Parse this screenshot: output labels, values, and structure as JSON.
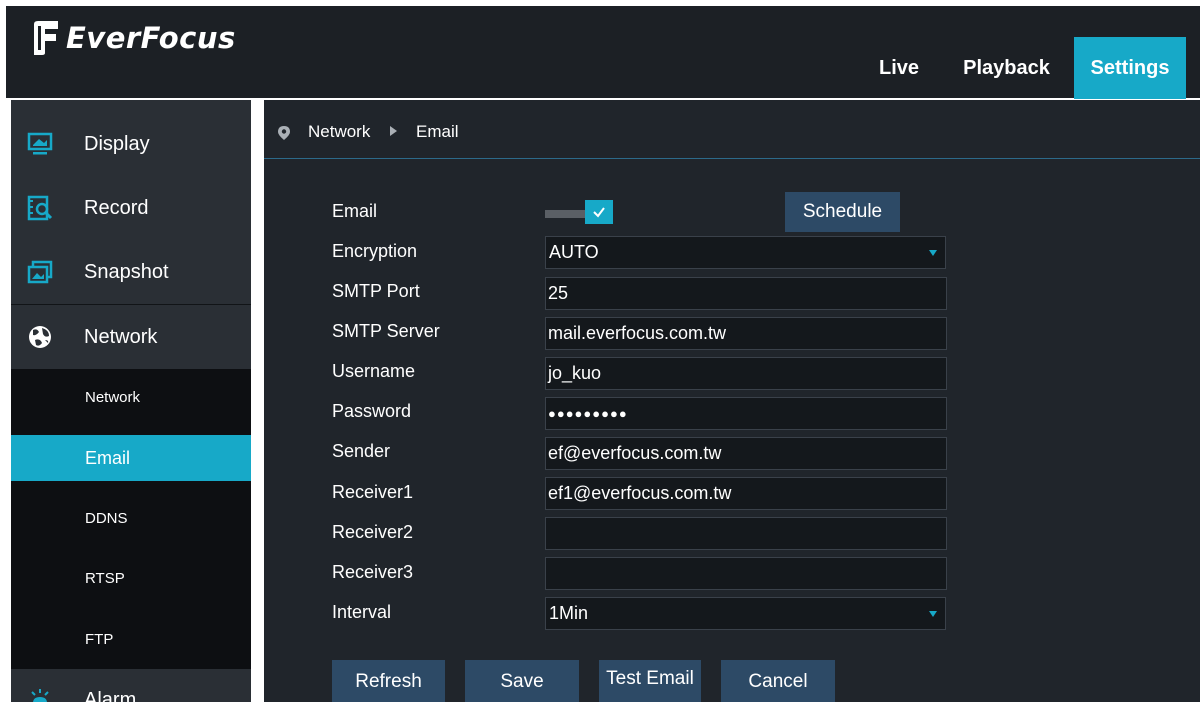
{
  "brand": {
    "name": "EverFocus"
  },
  "top_nav": {
    "live": "Live",
    "playback": "Playback",
    "settings": "Settings"
  },
  "sidebar": {
    "items": [
      {
        "label": "Display",
        "icon": "monitor-icon"
      },
      {
        "label": "Record",
        "icon": "record-search-icon"
      },
      {
        "label": "Snapshot",
        "icon": "snapshot-icon"
      },
      {
        "label": "Network",
        "icon": "globe-icon"
      },
      {
        "label": "Alarm",
        "icon": "alarm-icon"
      }
    ],
    "network_submenu": [
      "Network",
      "Email",
      "DDNS",
      "RTSP",
      "FTP"
    ],
    "active_submenu": "Email"
  },
  "breadcrumb": {
    "section": "Network",
    "page": "Email"
  },
  "form": {
    "email_label": "Email",
    "email_enabled": true,
    "schedule_button": "Schedule",
    "encryption_label": "Encryption",
    "encryption_value": "AUTO",
    "smtp_port_label": "SMTP Port",
    "smtp_port_value": "25",
    "smtp_server_label": "SMTP Server",
    "smtp_server_value": "mail.everfocus.com.tw",
    "username_label": "Username",
    "username_value": "jo_kuo",
    "password_label": "Password",
    "password_value": "●●●●●●●●●",
    "sender_label": "Sender",
    "sender_value": "ef@everfocus.com.tw",
    "receiver1_label": "Receiver1",
    "receiver1_value": "ef1@everfocus.com.tw",
    "receiver2_label": "Receiver2",
    "receiver2_value": "",
    "receiver3_label": "Receiver3",
    "receiver3_value": "",
    "interval_label": "Interval",
    "interval_value": "1Min"
  },
  "buttons": {
    "refresh": "Refresh",
    "save": "Save",
    "test_email": "Test Email",
    "cancel": "Cancel"
  },
  "colors": {
    "accent": "#17a9c8",
    "button": "#2d4a66",
    "header": "#1c2025",
    "sidebar": "#2a2f35",
    "content": "#20252b"
  }
}
